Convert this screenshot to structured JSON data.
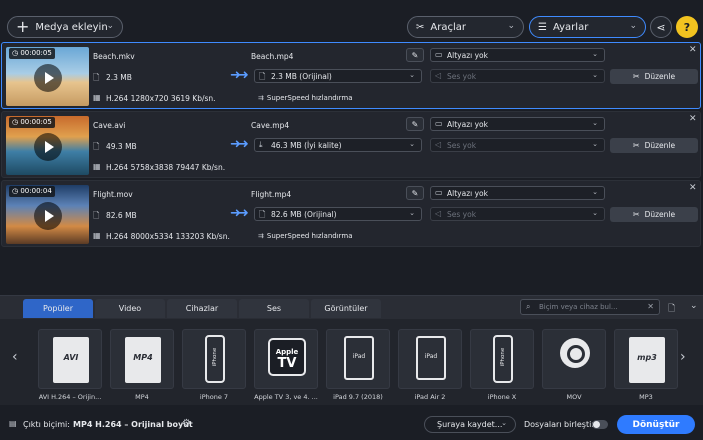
{
  "colors": {
    "accent": "#2f7bff",
    "help": "#f2c320",
    "active_border": "#3f8bff"
  },
  "topbar": {
    "add_media_label": "Medya ekleyin",
    "tools_label": "Araçlar",
    "settings_label": "Ayarlar",
    "share_icon": "share-icon",
    "help_label": "?"
  },
  "files": [
    {
      "duration": "00:00:05",
      "name": "Beach.mkv",
      "size": "2.3 MB",
      "codec": "H.264 1280x720 3619 Kb/sn.",
      "output_name": "Beach.mp4",
      "output_size": "2.3 MB (Orijinal)",
      "subtitle": "Altyazı yok",
      "audio": "Ses yok",
      "edit_label": "Düzenle",
      "superspeed": "SuperSpeed hızlandırma",
      "active": true
    },
    {
      "duration": "00:00:05",
      "name": "Cave.avi",
      "size": "49.3 MB",
      "codec": "H.264 5758x3838 79447 Kb/sn.",
      "output_name": "Cave.mp4",
      "output_size": "46.3 MB (İyi kalite)",
      "subtitle": "Altyazı yok",
      "audio": "Ses yok",
      "edit_label": "Düzenle",
      "superspeed": "",
      "active": false
    },
    {
      "duration": "00:00:04",
      "name": "Flight.mov",
      "size": "82.6 MB",
      "codec": "H.264 8000x5334 133203 Kb/sn.",
      "output_name": "Flight.mp4",
      "output_size": "82.6 MB (Orijinal)",
      "subtitle": "Altyazı yok",
      "audio": "Ses yok",
      "edit_label": "Düzenle",
      "superspeed": "SuperSpeed hızlandırma",
      "active": false
    }
  ],
  "format_panel": {
    "tabs": [
      "Popüler",
      "Video",
      "Cihazlar",
      "Ses",
      "Görüntüler"
    ],
    "active_tab": "Popüler",
    "search_placeholder": "Biçim veya cihaz bul...",
    "tiles": [
      {
        "label": "AVI H.264 – Orijin...",
        "icon": "AVI"
      },
      {
        "label": "MP4",
        "icon": "MP4"
      },
      {
        "label": "iPhone 7",
        "icon": "iPhone"
      },
      {
        "label": "Apple TV 3, ve 4. ...",
        "icon_top": "Apple",
        "icon_bottom": "TV"
      },
      {
        "label": "iPad 9.7 (2018)",
        "icon": "iPad"
      },
      {
        "label": "iPad Air 2",
        "icon": "iPad"
      },
      {
        "label": "iPhone X",
        "icon": "iPhone"
      },
      {
        "label": "MOV",
        "icon": "quicktime-icon"
      },
      {
        "label": "MP3",
        "icon": "mp3"
      }
    ]
  },
  "bottombar": {
    "output_format_label": "Çıktı biçimi:",
    "output_format_value": "MP4 H.264 – Orijinal boyut",
    "save_to_label": "Şuraya kaydet...",
    "merge_label": "Dosyaları birleştir:",
    "convert_label": "Dönüştür"
  }
}
